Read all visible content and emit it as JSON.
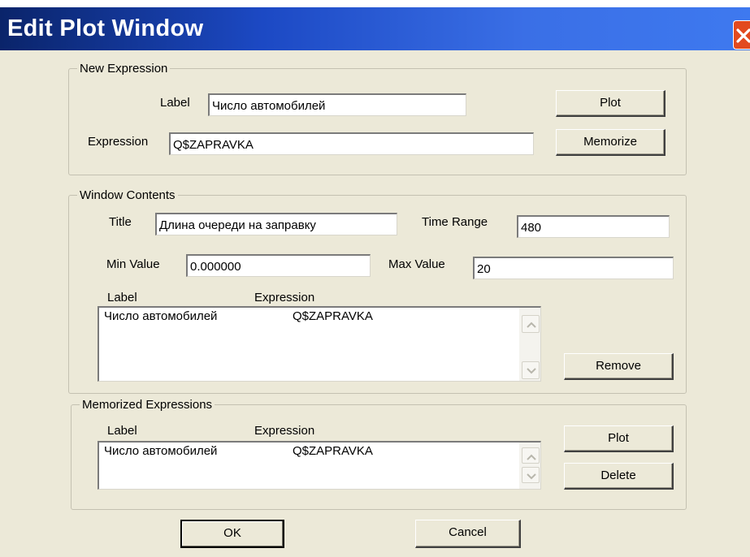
{
  "window": {
    "title": "Edit Plot Window"
  },
  "new_expression": {
    "legend": "New Expression",
    "label_caption": "Label",
    "label_value": "Число автомобилей",
    "expression_caption": "Expression",
    "expression_value": "Q$ZAPRAVKA",
    "plot_button": "Plot",
    "memorize_button": "Memorize"
  },
  "window_contents": {
    "legend": "Window Contents",
    "title_caption": "Title",
    "title_value": "Длина очереди на заправку",
    "time_range_caption": "Time Range",
    "time_range_value": "480",
    "min_value_caption": "Min Value",
    "min_value": "0.000000",
    "max_value_caption": "Max Value",
    "max_value": "20",
    "col_label": "Label",
    "col_expression": "Expression",
    "rows": [
      {
        "label": "Число автомобилей",
        "expression": "Q$ZAPRAVKA"
      }
    ],
    "remove_button": "Remove"
  },
  "memorized": {
    "legend": "Memorized Expressions",
    "col_label": "Label",
    "col_expression": "Expression",
    "rows": [
      {
        "label": "Число автомобилей",
        "expression": "Q$ZAPRAVKA"
      }
    ],
    "plot_button": "Plot",
    "delete_button": "Delete"
  },
  "footer": {
    "ok_button": "OK",
    "cancel_button": "Cancel"
  },
  "colors": {
    "titlebar": "#1c49c4",
    "dialog_bg": "#ece9d8",
    "close": "#e24a1f"
  }
}
